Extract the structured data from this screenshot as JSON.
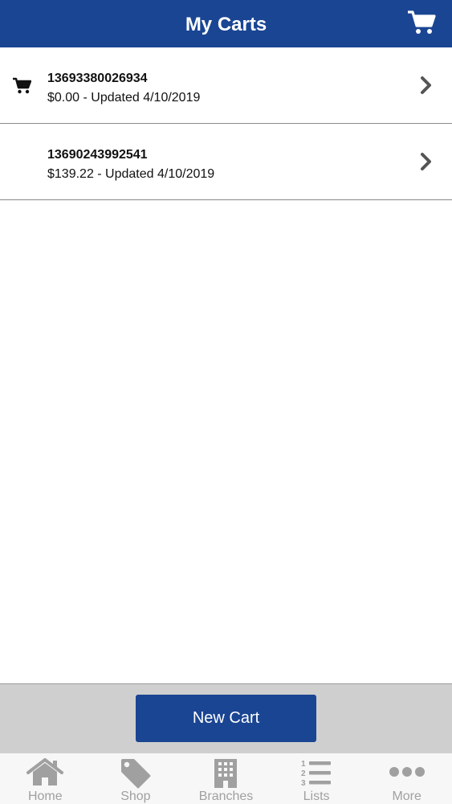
{
  "header": {
    "title": "My Carts",
    "cart_icon": "cart-icon"
  },
  "carts": [
    {
      "id": "13693380026934",
      "summary": "$0.00 - Updated 4/10/2019",
      "active": true
    },
    {
      "id": "13690243992541",
      "summary": "$139.22 - Updated 4/10/2019",
      "active": false
    }
  ],
  "footer": {
    "new_cart_label": "New Cart"
  },
  "tabs": [
    {
      "label": "Home",
      "icon": "home-icon"
    },
    {
      "label": "Shop",
      "icon": "tag-icon"
    },
    {
      "label": "Branches",
      "icon": "building-icon"
    },
    {
      "label": "Lists",
      "icon": "numbered-list-icon"
    },
    {
      "label": "More",
      "icon": "more-dots-icon"
    }
  ],
  "colors": {
    "brand": "#1a4592",
    "tab_inactive": "#a0a0a0",
    "footer_bg": "#cfcfcf"
  }
}
